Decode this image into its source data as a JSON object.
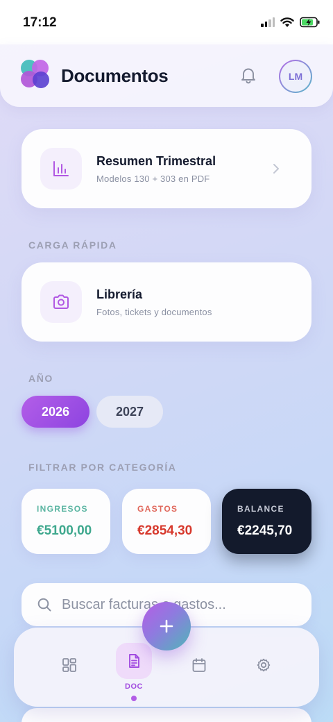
{
  "status_bar": {
    "time": "17:12"
  },
  "header": {
    "title": "Documentos",
    "avatar_initials": "LM"
  },
  "summary_card": {
    "title": "Resumen Trimestral",
    "subtitle": "Modelos 130 + 303 en PDF",
    "icon": "bar-chart-icon"
  },
  "quick_upload": {
    "section_label": "CARGA RÁPIDA",
    "title": "Librería",
    "subtitle": "Fotos, tickets y documentos",
    "icon": "camera-icon"
  },
  "year": {
    "section_label": "AÑO",
    "options": [
      "2026",
      "2027"
    ],
    "selected": "2026"
  },
  "filter": {
    "section_label": "FILTRAR POR CATEGORÍA",
    "categories": [
      {
        "label": "INGRESOS",
        "value": "€5100,00",
        "label_color": "#5bb5a2",
        "value_color": "#3fa88e"
      },
      {
        "label": "GASTOS",
        "value": "€2854,30",
        "label_color": "#e0675b",
        "value_color": "#d73a2e"
      },
      {
        "label": "BALANCE",
        "value": "€2245,70",
        "label_color": "#c6cad6",
        "value_color": "#ffffff"
      }
    ]
  },
  "search": {
    "placeholder": "Buscar facturas o gastos..."
  },
  "bottom_nav": {
    "items": [
      {
        "name": "dashboard",
        "icon": "grid-icon"
      },
      {
        "name": "doc",
        "icon": "document-icon",
        "label": "DOC"
      },
      {
        "name": "calendar",
        "icon": "calendar-icon"
      },
      {
        "name": "settings",
        "icon": "gear-icon"
      }
    ],
    "active_label": "DOC"
  },
  "colors": {
    "accent": "#a24de0",
    "dark_card": "#131a2c"
  }
}
